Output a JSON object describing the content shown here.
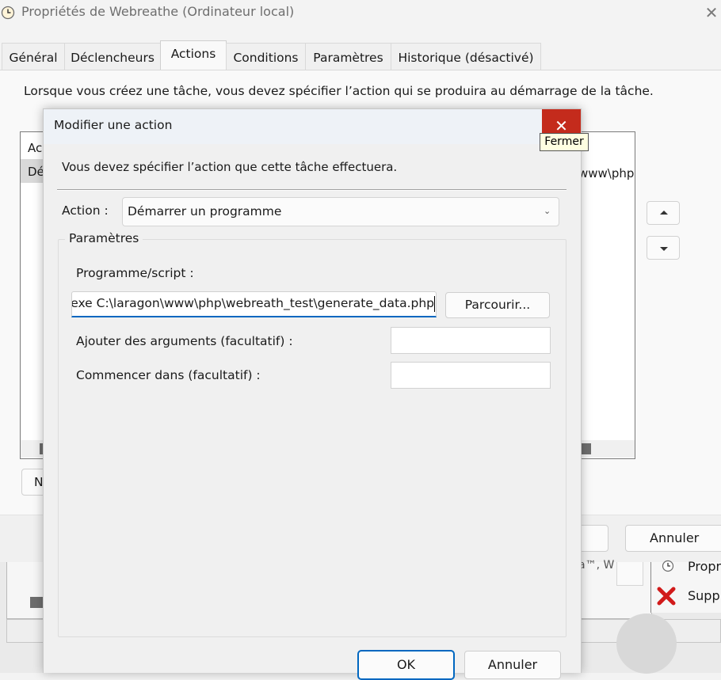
{
  "back_window": {
    "title": "Propriétés de Webreathe (Ordinateur local)",
    "close_glyph": "✕",
    "tabs": [
      {
        "label": "Général",
        "active": false
      },
      {
        "label": "Déclencheurs",
        "active": false
      },
      {
        "label": "Actions",
        "active": true
      },
      {
        "label": "Conditions",
        "active": false
      },
      {
        "label": "Paramètres",
        "active": false
      },
      {
        "label": "Historique (désactivé)",
        "active": false
      }
    ],
    "description": "Lorsque vous créez une tâche, vous devez spécifier l’action qui se produira au démarrage de la tâche.",
    "list_header_fragment": "Ac",
    "list_row_fragment": "Dé",
    "list_row_tail_fragment": "www\\php",
    "new_button_fragment": "N",
    "cancel_label": "Annuler"
  },
  "background_app": {
    "panel_text_fragment": "a™, W",
    "properties_fragment": "Propr",
    "delete_fragment": "Supp"
  },
  "dialog": {
    "title": "Modifier une action",
    "close_glyph": "✕",
    "close_tooltip": "Fermer",
    "description": "Vous devez spécifier l’action que cette tâche effectuera.",
    "action_label": "Action :",
    "action_value": "Démarrer un programme",
    "chevron_glyph": "⌄",
    "params_title": "Paramètres",
    "program_label": "Programme/script :",
    "program_value": "exe C:\\laragon\\www\\php\\webreath_test\\generate_data.php",
    "browse_label": "Parcourir...",
    "args_label": "Ajouter des arguments (facultatif) :",
    "args_value": "",
    "start_in_label": "Commencer dans (facultatif) :",
    "start_in_value": "",
    "ok_label": "OK",
    "cancel_label": "Annuler"
  },
  "colors": {
    "accent": "#0067c0",
    "close_red": "#c42b1c",
    "tooltip_bg": "#ffffe1"
  }
}
